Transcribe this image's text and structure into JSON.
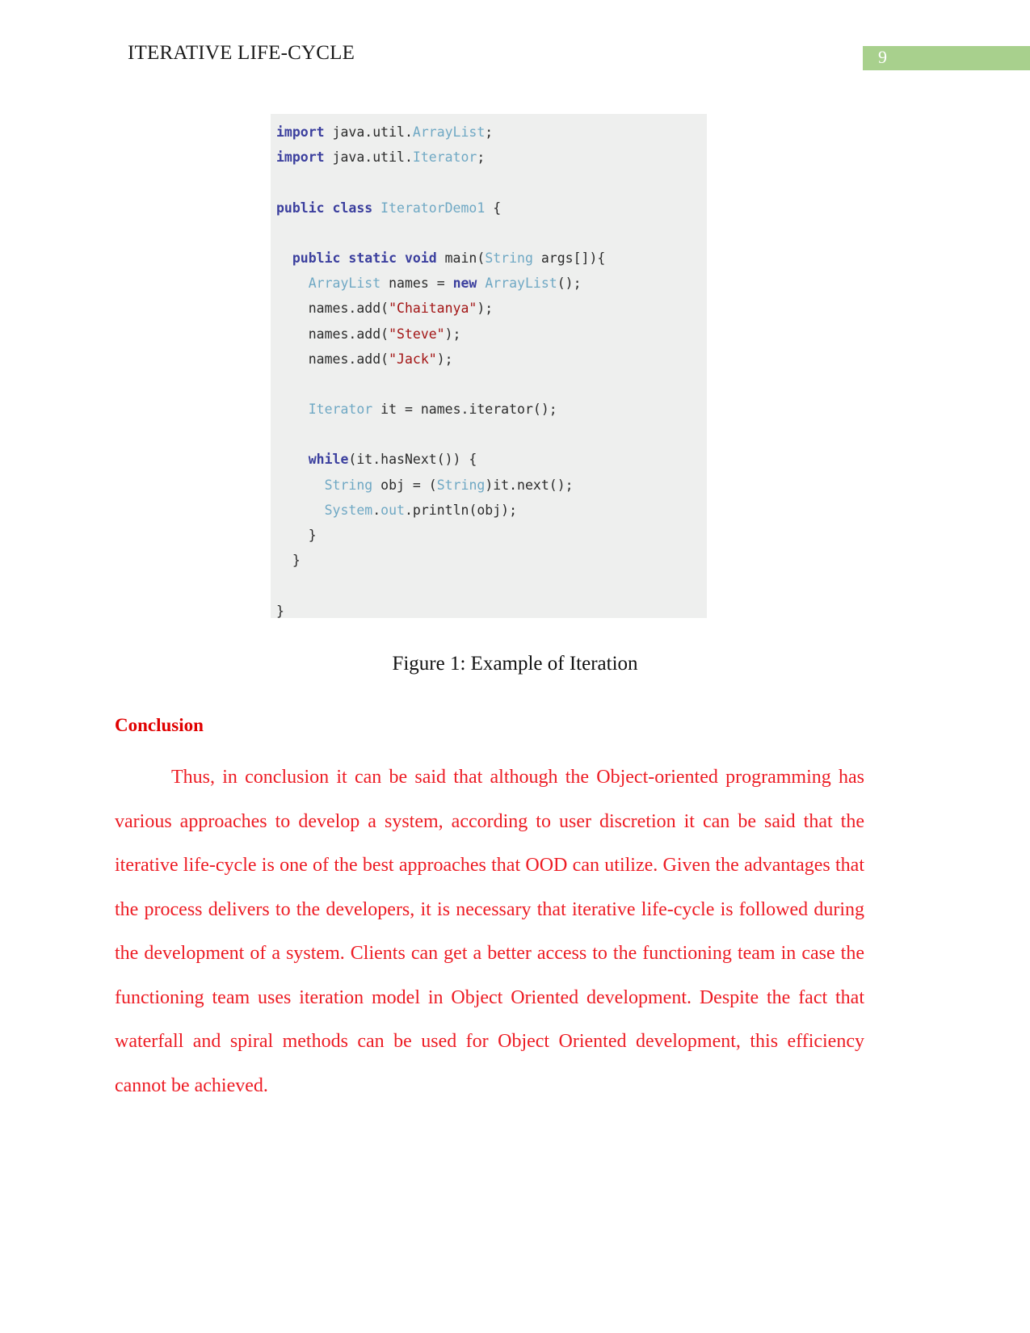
{
  "header": {
    "title": "ITERATIVE LIFE-CYCLE",
    "page_number": "9",
    "badge_color": "#a8d08d"
  },
  "figure": {
    "caption": "Figure 1: Example of Iteration",
    "background_color": "#eeefee",
    "language": "java",
    "code_lines": [
      [
        {
          "t": "import",
          "c": "kw"
        },
        {
          "t": " java.util.",
          "c": "plain"
        },
        {
          "t": "ArrayList",
          "c": "typ"
        },
        {
          "t": ";",
          "c": "punc"
        }
      ],
      [
        {
          "t": "import",
          "c": "kw"
        },
        {
          "t": " java.util.",
          "c": "plain"
        },
        {
          "t": "Iterator",
          "c": "typ"
        },
        {
          "t": ";",
          "c": "punc"
        }
      ],
      [],
      [
        {
          "t": "public class ",
          "c": "kw"
        },
        {
          "t": "IteratorDemo1",
          "c": "typ"
        },
        {
          "t": " {",
          "c": "punc"
        }
      ],
      [],
      [
        {
          "t": "  ",
          "c": "plain"
        },
        {
          "t": "public static void ",
          "c": "kw"
        },
        {
          "t": "main",
          "c": "plain"
        },
        {
          "t": "(",
          "c": "punc"
        },
        {
          "t": "String",
          "c": "typ"
        },
        {
          "t": " args[]){",
          "c": "plain"
        }
      ],
      [
        {
          "t": "    ",
          "c": "plain"
        },
        {
          "t": "ArrayList",
          "c": "typ"
        },
        {
          "t": " names = ",
          "c": "plain"
        },
        {
          "t": "new",
          "c": "kw"
        },
        {
          "t": " ",
          "c": "plain"
        },
        {
          "t": "ArrayList",
          "c": "typ"
        },
        {
          "t": "();",
          "c": "punc"
        }
      ],
      [
        {
          "t": "    names.add(",
          "c": "plain"
        },
        {
          "t": "\"Chaitanya\"",
          "c": "str"
        },
        {
          "t": ");",
          "c": "punc"
        }
      ],
      [
        {
          "t": "    names.add(",
          "c": "plain"
        },
        {
          "t": "\"Steve\"",
          "c": "str"
        },
        {
          "t": ");",
          "c": "punc"
        }
      ],
      [
        {
          "t": "    names.add(",
          "c": "plain"
        },
        {
          "t": "\"Jack\"",
          "c": "str"
        },
        {
          "t": ");",
          "c": "punc"
        }
      ],
      [],
      [
        {
          "t": "    ",
          "c": "plain"
        },
        {
          "t": "Iterator",
          "c": "typ"
        },
        {
          "t": " it = names.iterator();",
          "c": "plain"
        }
      ],
      [],
      [
        {
          "t": "    ",
          "c": "plain"
        },
        {
          "t": "while",
          "c": "kw"
        },
        {
          "t": "(it.hasNext()) {",
          "c": "plain"
        }
      ],
      [
        {
          "t": "      ",
          "c": "plain"
        },
        {
          "t": "String",
          "c": "typ"
        },
        {
          "t": " obj = (",
          "c": "plain"
        },
        {
          "t": "String",
          "c": "typ"
        },
        {
          "t": ")it.next();",
          "c": "plain"
        }
      ],
      [
        {
          "t": "      ",
          "c": "plain"
        },
        {
          "t": "System",
          "c": "typ"
        },
        {
          "t": ".",
          "c": "punc"
        },
        {
          "t": "out",
          "c": "typ"
        },
        {
          "t": ".println(obj);",
          "c": "plain"
        }
      ],
      [
        {
          "t": "    }",
          "c": "punc"
        }
      ],
      [
        {
          "t": "  }",
          "c": "punc"
        }
      ],
      [],
      [
        {
          "t": "}",
          "c": "punc"
        }
      ]
    ]
  },
  "conclusion": {
    "heading": "Conclusion",
    "heading_color": "#e00000",
    "body_color": "#ed1c24",
    "body": "Thus, in conclusion it can be said that although the Object-oriented programming has various approaches to develop a system, according to user discretion it can be said that the iterative life-cycle is one of the best approaches that OOD can utilize. Given the advantages that the process delivers to the developers, it is necessary that iterative life-cycle is followed during the development of a system. Clients can get a better access to the functioning team in case the functioning team uses iteration model in Object Oriented development. Despite the fact that waterfall and spiral methods can be used for Object Oriented development, this efficiency cannot be achieved."
  }
}
